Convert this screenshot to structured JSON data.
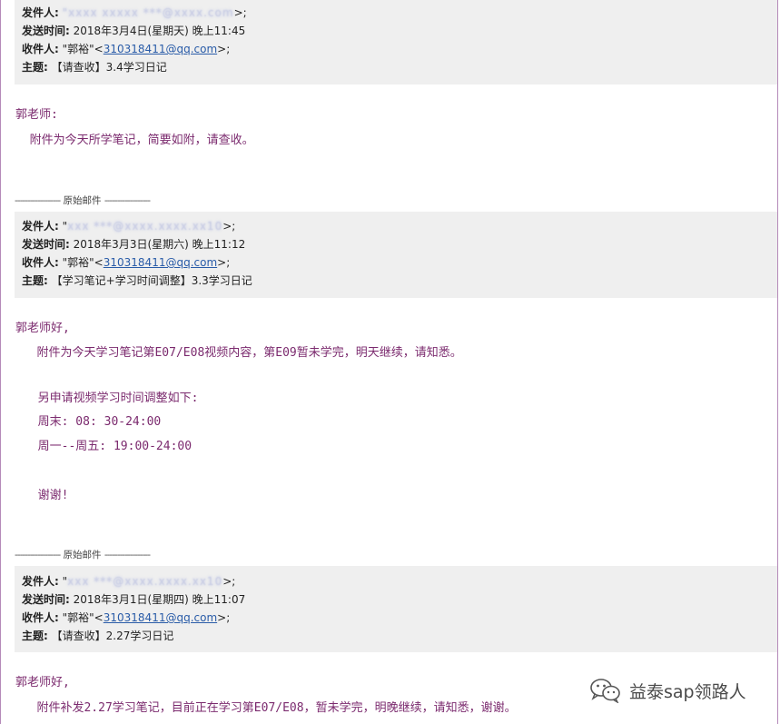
{
  "email1": {
    "from_label": "发件人:",
    "from_value_tail": ">;",
    "sent_label": "发送时间:",
    "sent_value": "2018年3月4日(星期天) 晚上11:45",
    "to_label": "收件人:",
    "to_name": "\"郭裕\"<",
    "to_email": "310318411@qq.com",
    "to_tail": ">;",
    "subject_label": "主题:",
    "subject_value": "【请查收】3.4学习日记",
    "greeting": "郭老师:",
    "lines": [
      "  附件为今天所学笔记，简要如附，请查收。"
    ]
  },
  "divider_text": "原始邮件",
  "divider_dashes": "------------------",
  "email2": {
    "from_label": "发件人:",
    "from_value_head": "\"",
    "from_value_tail": ">;",
    "sent_label": "发送时间:",
    "sent_value": "2018年3月3日(星期六) 晚上11:12",
    "to_label": "收件人:",
    "to_name": "\"郭裕\"<",
    "to_email": "310318411@qq.com",
    "to_tail": ">;",
    "subject_label": "主题:",
    "subject_value": "【学习笔记+学习时间调整】3.3学习日记",
    "greeting": "郭老师好,",
    "lines": [
      "   附件为今天学习笔记第E07/E08视频内容，第E09暂未学完，明天继续，请知悉。",
      "",
      "  另申请视频学习时间调整如下:",
      "  周末: 08: 30-24:00",
      "  周一--周五: 19:00-24:00",
      "",
      "  谢谢!"
    ]
  },
  "email3": {
    "from_label": "发件人:",
    "from_value_head": "\"",
    "from_value_tail": ">;",
    "sent_label": "发送时间:",
    "sent_value": "2018年3月1日(星期四) 晚上11:07",
    "to_label": "收件人:",
    "to_name": "\"郭裕\"<",
    "to_email": "310318411@qq.com",
    "to_tail": ">;",
    "subject_label": "主题:",
    "subject_value": "【请查收】2.27学习日记",
    "greeting": "郭老师好,",
    "lines": [
      "   附件补发2.27学习笔记，目前正在学习第E07/E08，暂未学完，明晚继续，请知悉，谢谢。"
    ]
  },
  "watermark": {
    "text": "益泰sap领路人",
    "icon": "wechat-icon"
  },
  "colors": {
    "body_text": "#7b2a6e",
    "header_bg": "#efefef",
    "link": "#2a5ca8",
    "border": "#b58ab9"
  }
}
